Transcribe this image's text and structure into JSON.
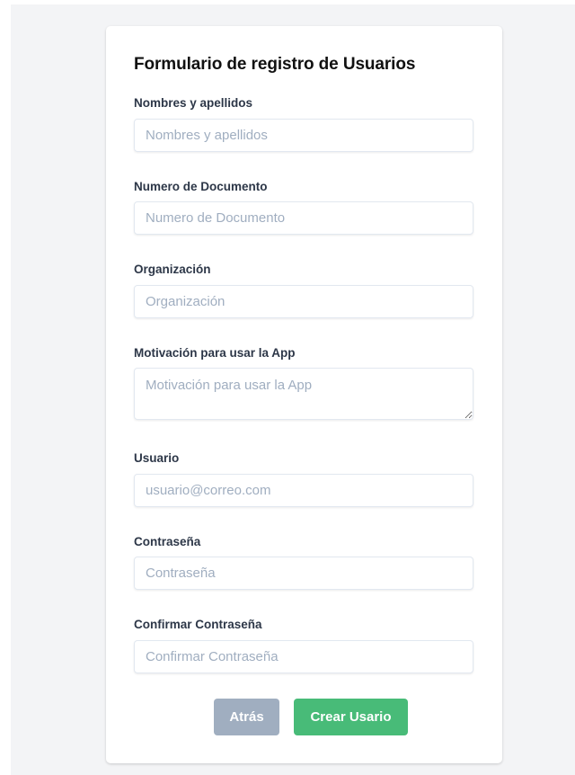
{
  "form": {
    "title": "Formulario de registro de Usuarios",
    "fields": [
      {
        "label": "Nombres y apellidos",
        "placeholder": "Nombres y apellidos",
        "value": ""
      },
      {
        "label": "Numero de Documento",
        "placeholder": "Numero de Documento",
        "value": ""
      },
      {
        "label": "Organización",
        "placeholder": "Organización",
        "value": ""
      },
      {
        "label": "Motivación para usar la App",
        "placeholder": "Motivación para usar la App",
        "value": ""
      },
      {
        "label": "Usuario",
        "placeholder": "usuario@correo.com",
        "value": ""
      },
      {
        "label": "Contraseña",
        "placeholder": "Contraseña",
        "value": ""
      },
      {
        "label": "Confirmar Contraseña",
        "placeholder": "Confirmar Contraseña",
        "value": ""
      }
    ],
    "buttons": {
      "back_label": "Atrás",
      "create_label": "Crear Usario"
    }
  },
  "colors": {
    "page_background": "#f3f4f6",
    "card_background": "#ffffff",
    "back_button": "#a0aec0",
    "create_button": "#48bb78",
    "label_text": "#2d3748",
    "placeholder_text": "#a0aec0"
  }
}
